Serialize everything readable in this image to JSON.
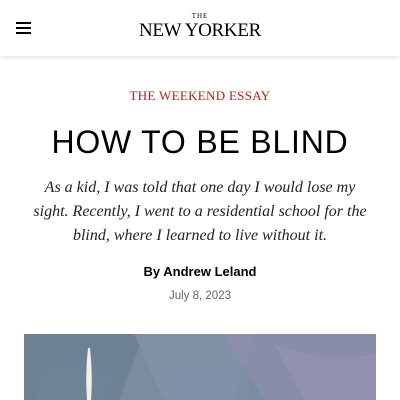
{
  "header": {
    "menu_icon": "hamburger-menu-icon",
    "logo_the": "THE",
    "logo_name": "NEW YORKER"
  },
  "article": {
    "rubric": "THE WEEKEND ESSAY",
    "headline": "HOW TO BE BLIND",
    "dek": "As a kid, I was told that one day I would lose my sight. Recently, I went to a residential school for the blind, where I learned to live without it.",
    "byline_prefix": "By",
    "author": "Andrew Leland",
    "date": "July 8, 2023"
  },
  "colors": {
    "rubric": "#c4161c",
    "text": "#000000",
    "date": "#666666"
  }
}
